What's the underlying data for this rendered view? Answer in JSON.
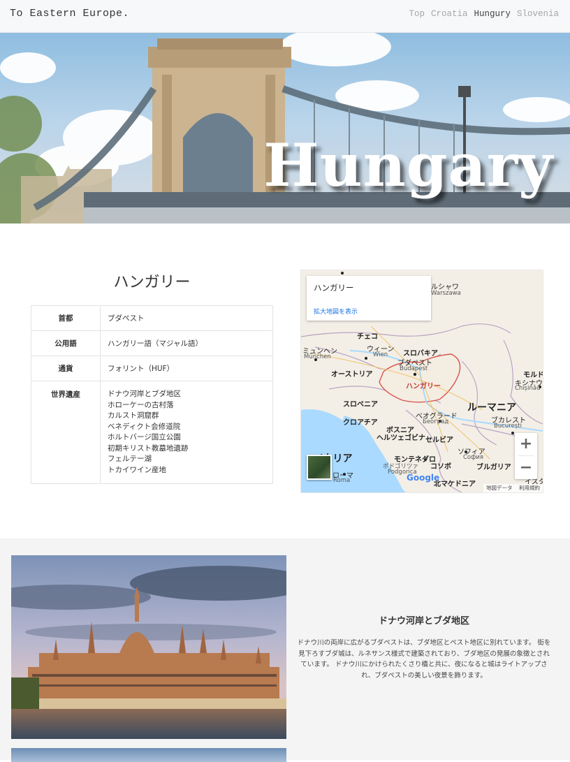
{
  "header": {
    "brand": "To Eastern Europe.",
    "nav": [
      {
        "label": "Top"
      },
      {
        "label": "Croatia"
      },
      {
        "label": "Hungury"
      },
      {
        "label": "Slovenia"
      }
    ]
  },
  "hero": {
    "title": "Hungary"
  },
  "info": {
    "title": "ハンガリー",
    "rows": [
      {
        "key": "首都",
        "value": "ブダペスト"
      },
      {
        "key": "公用語",
        "value": "ハンガリー語（マジャル語）"
      },
      {
        "key": "通貨",
        "value": "フォリント（HUF）"
      }
    ],
    "heritage_key": "世界遺産",
    "heritage": [
      "ドナウ河岸とブダ地区",
      "ホローケーの古村落",
      "カルスト洞窟群",
      "ベネディクト会修道院",
      "ホルトバージ国立公園",
      "初期キリスト教墓地遺跡",
      "フェルテー湖",
      "トカイワイン産地"
    ]
  },
  "map": {
    "card_title": "ハンガリー",
    "card_link": "拡大地図を表示",
    "labels": {
      "warsaw": "ルシャワ",
      "warsaw_en": "Warszawa",
      "czech": "チェコ",
      "munich": "ミュンヘン",
      "munich_en": "München",
      "vienna": "ウィーン",
      "vienna_en": "Wien",
      "slovakia": "スロバキア",
      "budapest": "ブダペスト",
      "budapest_en": "Budapest",
      "austria": "オーストリア",
      "hungary": "ハンガリー",
      "moldova": "モルド",
      "chisinau": "キシナウ",
      "chisinau_en": "Chișinău",
      "slovenia": "スロベニア",
      "romania": "ルーマニア",
      "croatia": "クロアチア",
      "belgrade": "ベオグラード",
      "belgrade_en": "Београд",
      "bucharest": "ブカレスト",
      "bucharest_en": "București",
      "bosnia1": "ボスニア",
      "bosnia2": "ヘルツェゴビナ",
      "serbia": "セルビア",
      "italy": "イタリア",
      "sofia": "ソフィア",
      "sofia_en": "София",
      "montenegro": "モンテネグロ",
      "podgorica": "ポドゴリツァ",
      "podgorica_en": "Podgorica",
      "kosovo": "コソボ",
      "bulgaria": "ブルガリア",
      "rome": "ローマ",
      "rome_en": "Roma",
      "macedonia": "北マケドニア",
      "istanbul": "イスタ"
    },
    "zoom_in": "+",
    "zoom_out": "−",
    "google": "Google",
    "footer_data": "地図データ",
    "footer_terms": "利用規約"
  },
  "feature": {
    "title": "ドナウ河岸とブダ地区",
    "text": "ドナウ川の両岸に広がるブダペストは、ブダ地区とペスト地区に別れています。 街を見下ろすブダ城は、ルネサンス様式で建築されており、ブダ地区の発展の象徴とされています。 ドナウ川にかけられたくさり橋と共に、夜になると城はライトアップされ、ブダペストの美しい夜景を飾ります。"
  }
}
